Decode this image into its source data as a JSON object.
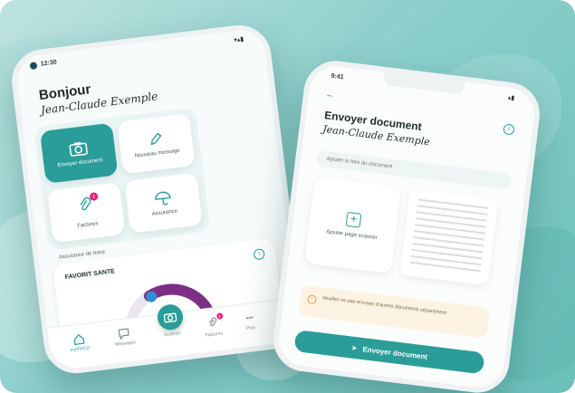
{
  "colors": {
    "accent": "#2a9d98",
    "badge": "#e5237a",
    "gauge": "#7d2f86",
    "background": "#8ccfcb"
  },
  "left_phone": {
    "status_time": "12:30",
    "greeting": "Bonjour",
    "user_name": "Jean-Claude Exemple",
    "tiles": [
      {
        "label": "Envoyer document",
        "icon": "camera-icon"
      },
      {
        "label": "Nouveau message",
        "icon": "pencil-icon"
      },
      {
        "label": "Factures",
        "icon": "paperclip-icon",
        "badge": "1"
      },
      {
        "label": "Assurance",
        "icon": "umbrella-icon"
      }
    ],
    "section_title": "Assurance de base",
    "card_title": "FAVORIT SANTE",
    "nav": [
      {
        "label": "myVIVCA",
        "icon": "home-icon"
      },
      {
        "label": "Messages",
        "icon": "chat-icon"
      },
      {
        "label": "Scanner",
        "icon": "camera-icon"
      },
      {
        "label": "Factures",
        "icon": "paperclip-icon",
        "badge": "1"
      },
      {
        "label": "Plus",
        "icon": "more-icon"
      }
    ]
  },
  "right_phone": {
    "status_time": "9:41",
    "title": "Envoyer document",
    "user_name": "Jean-Claude Exemple",
    "input_placeholder": "Ajouter le titre du document",
    "add_page_label": "Ajouter page scanner",
    "info_text": "Veuillez ne pas envoyer d’autres documents séparément",
    "send_button": "Envoyer document"
  }
}
